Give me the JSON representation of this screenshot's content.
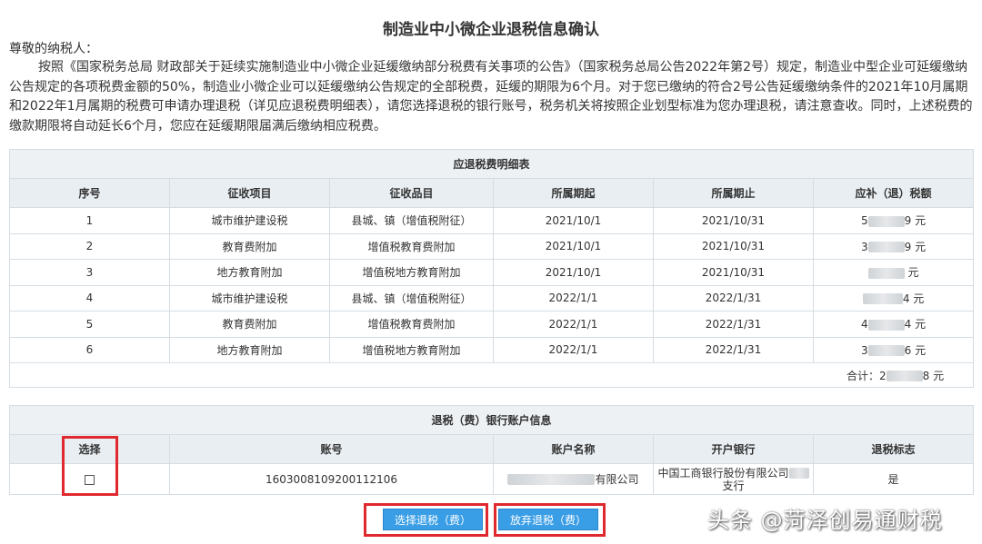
{
  "page": {
    "title": "制造业中小微企业退税信息确认",
    "greeting": "尊敬的纳税人：",
    "notice": "按照《国家税务总局 财政部关于延续实施制造业中小微企业延缓缴纳部分税费有关事项的公告》（国家税务总局公告2022年第2号）规定，制造业中型企业可延缓缴纳公告规定的各项税费金额的50%，制造业小微企业可以延缓缴纳公告规定的全部税费，延缓的期限为6个月。对于您已缴纳的符合2号公告延缓缴纳条件的2021年10月属期和2022年1月属期的税费可申请办理退税（详见应退税费明细表），请您选择退税的银行账号，税务机关将按照企业划型标准为您办理退税，请注意查收。同时，上述税费的缴款期限将自动延长6个月，您应在延缓期限届满后缴纳相应税费。"
  },
  "detail": {
    "caption": "应退税费明细表",
    "headers": [
      "序号",
      "征收项目",
      "征收品目",
      "所属期起",
      "所属期止",
      "应补（退）税额"
    ],
    "rows": [
      {
        "no": "1",
        "item": "城市维护建设税",
        "sub": "县城、镇（增值税附征）",
        "start": "2021/10/1",
        "end": "2021/10/31",
        "amt_pre": "5",
        "amt_suf": "9 元"
      },
      {
        "no": "2",
        "item": "教育费附加",
        "sub": "增值税教育费附加",
        "start": "2021/10/1",
        "end": "2021/10/31",
        "amt_pre": "3",
        "amt_suf": "9 元"
      },
      {
        "no": "3",
        "item": "地方教育附加",
        "sub": "增值税地方教育附加",
        "start": "2021/10/1",
        "end": "2021/10/31",
        "amt_pre": "",
        "amt_suf": "元"
      },
      {
        "no": "4",
        "item": "城市维护建设税",
        "sub": "县城、镇（增值税附征）",
        "start": "2022/1/1",
        "end": "2022/1/31",
        "amt_pre": "",
        "amt_suf": "4 元"
      },
      {
        "no": "5",
        "item": "教育费附加",
        "sub": "增值税教育费附加",
        "start": "2022/1/1",
        "end": "2022/1/31",
        "amt_pre": "4",
        "amt_suf": "4 元"
      },
      {
        "no": "6",
        "item": "地方教育附加",
        "sub": "增值税地方教育附加",
        "start": "2022/1/1",
        "end": "2022/1/31",
        "amt_pre": "3",
        "amt_suf": "6 元"
      }
    ],
    "total_pre": "合计：2",
    "total_suf": "8 元"
  },
  "bank": {
    "caption": "退税（费）银行账户信息",
    "headers": [
      "选择",
      "账号",
      "账户名称",
      "开户银行",
      "退税标志"
    ],
    "row": {
      "account": "1603008109200112106",
      "name_suf": "有限公司",
      "bank_line1": "中国工商银行股份有限公司",
      "bank_line2": "支行",
      "flag": "是"
    }
  },
  "buttons": {
    "select": "选择退税（费）",
    "abandon": "放弃退税（费）"
  },
  "watermark": "头条 @菏泽创易通财税",
  "colors": {
    "header_bg": "#e9eef2",
    "border": "#d5dde3",
    "button": "#3a9ee6",
    "highlight": "#e0292f"
  }
}
